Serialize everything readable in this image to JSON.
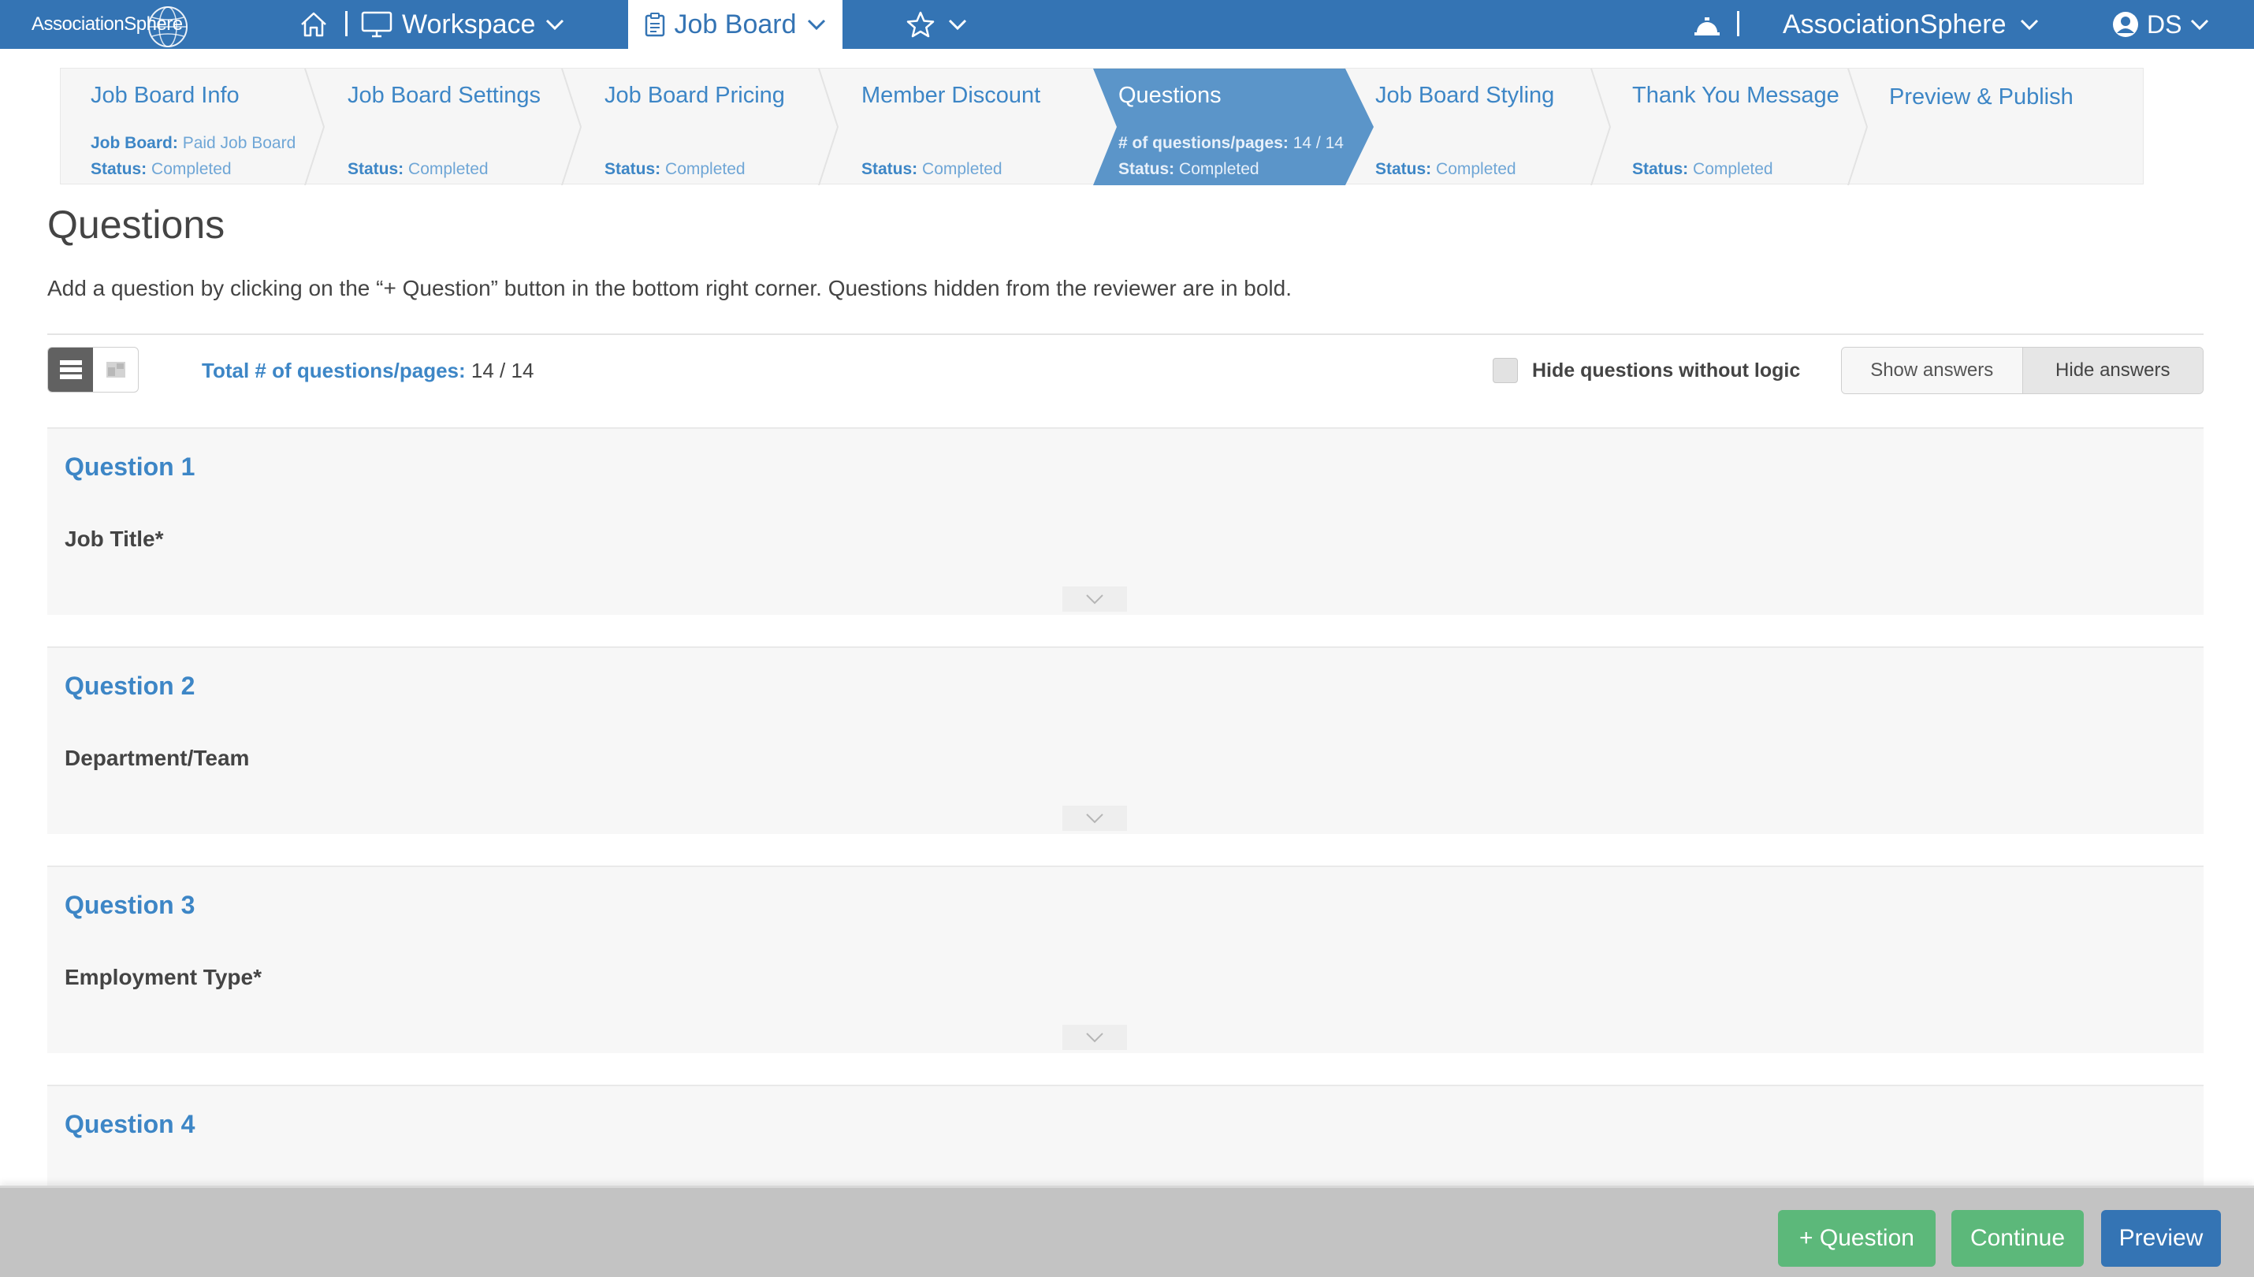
{
  "nav": {
    "logo": "AssociationSphere",
    "workspace_label": "Workspace",
    "jobboard_label": "Job Board",
    "org_label": "AssociationSphere",
    "user_initials": "DS"
  },
  "steps": [
    {
      "title": "Job Board Info",
      "line1_key": "Job Board:",
      "line1_val": "Paid Job Board",
      "line2_key": "Status:",
      "line2_val": "Completed"
    },
    {
      "title": "Job Board Settings",
      "line2_key": "Status:",
      "line2_val": "Completed"
    },
    {
      "title": "Job Board Pricing",
      "line2_key": "Status:",
      "line2_val": "Completed"
    },
    {
      "title": "Member Discount",
      "line2_key": "Status:",
      "line2_val": "Completed"
    },
    {
      "title": "Questions",
      "line1_key": "# of questions/pages:",
      "line1_val": "14 / 14",
      "line2_key": "Status:",
      "line2_val": "Completed"
    },
    {
      "title": "Job Board Styling",
      "line2_key": "Status:",
      "line2_val": "Completed"
    },
    {
      "title": "Thank You Message",
      "line2_key": "Status:",
      "line2_val": "Completed"
    },
    {
      "title": "Preview & Publish"
    }
  ],
  "page": {
    "title": "Questions",
    "intro": "Add a question by clicking on the “+ Question” button in the bottom right corner. Questions hidden from the reviewer are in bold."
  },
  "toolbar": {
    "total_label": "Total # of questions/pages:",
    "total_value": "14 / 14",
    "hide_logic_label": "Hide questions without logic",
    "show_answers": "Show answers",
    "hide_answers": "Hide answers"
  },
  "questions": [
    {
      "title": "Question 1",
      "text": "Job Title*"
    },
    {
      "title": "Question 2",
      "text": "Department/Team"
    },
    {
      "title": "Question 3",
      "text": "Employment Type*"
    },
    {
      "title": "Question 4",
      "text": ""
    }
  ],
  "footer": {
    "add_question": "+ Question",
    "continue": "Continue",
    "preview": "Preview"
  },
  "colors": {
    "brand_blue": "#3474b4",
    "link_blue": "#3d86c6",
    "green": "#5cb87a",
    "active_step": "#5b95c9"
  }
}
